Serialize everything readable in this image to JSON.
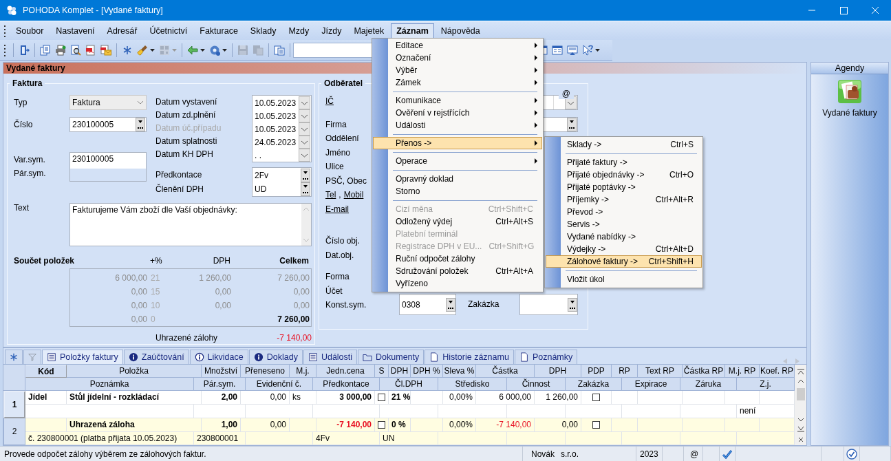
{
  "window": {
    "title": "POHODA Komplet - [Vydané faktury]"
  },
  "menubar": [
    {
      "label": "Soubor",
      "selected": false
    },
    {
      "label": "Nastavení",
      "selected": false
    },
    {
      "label": "Adresář",
      "selected": false
    },
    {
      "label": "Účetnictví",
      "selected": false
    },
    {
      "label": "Fakturace",
      "selected": false
    },
    {
      "label": "Sklady",
      "selected": false
    },
    {
      "label": "Mzdy",
      "selected": false
    },
    {
      "label": "Jízdy",
      "selected": false
    },
    {
      "label": "Majetek",
      "selected": false
    },
    {
      "label": "Záznam",
      "selected": true
    },
    {
      "label": "Nápověda",
      "selected": false
    }
  ],
  "toolbar": {
    "groups": [
      [
        {
          "kind": "door",
          "dropdown": false,
          "disabled": false
        }
      ],
      [
        {
          "kind": "copy",
          "dropdown": false,
          "disabled": false
        },
        {
          "kind": "print",
          "dropdown": false,
          "disabled": false
        },
        {
          "kind": "preview",
          "dropdown": false,
          "disabled": false
        },
        {
          "kind": "pdf",
          "dropdown": false,
          "disabled": false
        },
        {
          "kind": "pdf-mail",
          "dropdown": false,
          "disabled": false
        }
      ],
      [
        {
          "kind": "new",
          "dropdown": false,
          "disabled": false
        },
        {
          "kind": "brush",
          "dropdown": true,
          "disabled": false
        },
        {
          "kind": "qr",
          "dropdown": true,
          "disabled": true
        }
      ],
      [
        {
          "kind": "back",
          "dropdown": true,
          "disabled": false
        },
        {
          "kind": "gear",
          "dropdown": true,
          "disabled": false
        }
      ],
      [
        {
          "kind": "save",
          "dropdown": false,
          "disabled": true
        },
        {
          "kind": "duplicate",
          "dropdown": false,
          "disabled": true
        }
      ],
      [
        {
          "kind": "clipboard",
          "dropdown": false,
          "disabled": false
        }
      ]
    ],
    "right": [
      {
        "kind": "window",
        "dropdown": false,
        "disabled": false
      },
      {
        "kind": "table",
        "dropdown": false,
        "disabled": false
      },
      {
        "kind": "screen",
        "dropdown": false,
        "disabled": false
      },
      {
        "kind": "help",
        "dropdown": true,
        "disabled": false
      }
    ]
  },
  "section_title": "Vydané faktury",
  "faktura": {
    "title": "Faktura",
    "typ": {
      "label": "Typ",
      "value": "Faktura"
    },
    "cislo": {
      "label": "Číslo",
      "value": "230100005"
    },
    "sym": {
      "labels": [
        "Var.sym.",
        "Pár.sym."
      ],
      "value": "230100005"
    },
    "dates": [
      {
        "label": "Datum vystavení",
        "value": "10.05.2023",
        "disabled": false
      },
      {
        "label": "Datum zd.plnění",
        "value": "10.05.2023",
        "disabled": false
      },
      {
        "label": "Datum úč.případu",
        "value": "10.05.2023",
        "disabled": true
      },
      {
        "label": "Datum splatnosti",
        "value": "24.05.2023",
        "disabled": false
      },
      {
        "label": "Datum KH DPH",
        "value": ". .",
        "disabled": false
      }
    ],
    "predkontace": [
      {
        "label": "Předkontace",
        "value": "2Fv"
      },
      {
        "label": "Členění DPH",
        "value": "UD"
      }
    ],
    "text": {
      "label": "Text",
      "value": "Fakturujeme Vám zboží dle Vaší objednávky:"
    },
    "summary": {
      "title": "Součet položek",
      "columns": [
        "+%",
        "DPH",
        "Celkem"
      ],
      "rows": [
        {
          "kind": "rate",
          "base": "6 000,00",
          "rate": "21",
          "vat": "1 260,00",
          "total": "7 260,00"
        },
        {
          "kind": "rate",
          "base": "0,00",
          "rate": "15",
          "vat": "0,00",
          "total": "0,00"
        },
        {
          "kind": "rate",
          "base": "0,00",
          "rate": "10",
          "vat": "0,00",
          "total": "0,00"
        },
        {
          "kind": "total",
          "base": "0,00",
          "rate": "0",
          "total": "7 260,00"
        }
      ]
    },
    "advances": {
      "label": "Uhrazené zálohy",
      "value": "-7 140,00"
    }
  },
  "odberatel": {
    "title": "Odběratel",
    "at": "@",
    "groups": [
      [
        {
          "parts": [
            {
              "text": "IČ",
              "link": true
            }
          ]
        }
      ],
      [
        {
          "parts": [
            {
              "text": "Firma",
              "link": false
            }
          ]
        },
        {
          "parts": [
            {
              "text": "Oddělení",
              "link": false
            }
          ]
        },
        {
          "parts": [
            {
              "text": "Jméno",
              "link": false
            }
          ]
        },
        {
          "parts": [
            {
              "text": "Ulice",
              "link": false
            }
          ]
        },
        {
          "parts": [
            {
              "text": "PSČ, Obec",
              "link": false
            }
          ]
        },
        {
          "parts": [
            {
              "text": "Tel",
              "link": true
            },
            {
              "text": "Mobil",
              "link": true
            }
          ],
          "separator": ","
        },
        {
          "parts": [
            {
              "text": "E-mail",
              "link": true
            }
          ]
        }
      ],
      [
        {
          "parts": [
            {
              "text": "Číslo obj.",
              "link": false
            }
          ]
        },
        {
          "parts": [
            {
              "text": "Dat.obj.",
              "link": false
            }
          ]
        }
      ],
      [
        {
          "parts": [
            {
              "text": "Forma",
              "link": false
            }
          ]
        },
        {
          "parts": [
            {
              "text": "Účet",
              "link": false
            }
          ]
        },
        {
          "parts": [
            {
              "text": "Konst.sym.",
              "link": false
            }
          ]
        }
      ]
    ],
    "konst_sym": "0308",
    "zakazka_label": "Zakázka"
  },
  "menu": {
    "items": [
      {
        "kind": "item",
        "label": "Editace",
        "submenu": true,
        "disabled": false,
        "selected": false
      },
      {
        "kind": "item",
        "label": "Označení",
        "submenu": true,
        "disabled": false,
        "selected": false
      },
      {
        "kind": "item",
        "label": "Výběr",
        "submenu": true,
        "disabled": false,
        "selected": false
      },
      {
        "kind": "item",
        "label": "Zámek",
        "submenu": true,
        "disabled": false,
        "selected": false
      },
      {
        "kind": "separator"
      },
      {
        "kind": "item",
        "label": "Komunikace",
        "submenu": true,
        "disabled": false,
        "selected": false
      },
      {
        "kind": "item",
        "label": "Ověření v rejstřících",
        "submenu": true,
        "disabled": false,
        "selected": false
      },
      {
        "kind": "item",
        "label": "Události",
        "submenu": true,
        "disabled": false,
        "selected": false
      },
      {
        "kind": "separator"
      },
      {
        "kind": "item",
        "label": "Přenos ->",
        "submenu": true,
        "disabled": false,
        "selected": true
      },
      {
        "kind": "separator"
      },
      {
        "kind": "item",
        "label": "Operace",
        "submenu": true,
        "disabled": false,
        "selected": false
      },
      {
        "kind": "separator"
      },
      {
        "kind": "item",
        "label": "Opravný doklad",
        "submenu": false,
        "disabled": false,
        "selected": false
      },
      {
        "kind": "item",
        "label": "Storno",
        "submenu": false,
        "disabled": false,
        "selected": false
      },
      {
        "kind": "separator"
      },
      {
        "kind": "item",
        "label": "Cizí měna",
        "shortcut": "Ctrl+Shift+C",
        "submenu": false,
        "disabled": true,
        "selected": false
      },
      {
        "kind": "item",
        "label": "Odložený výdej",
        "shortcut": "Ctrl+Alt+S",
        "submenu": false,
        "disabled": false,
        "selected": false
      },
      {
        "kind": "item",
        "label": "Platební terminál",
        "submenu": false,
        "disabled": true,
        "selected": false
      },
      {
        "kind": "item",
        "label": "Registrace DPH v EU...",
        "shortcut": "Ctrl+Shift+G",
        "submenu": false,
        "disabled": true,
        "selected": false
      },
      {
        "kind": "item",
        "label": "Ruční odpočet zálohy",
        "submenu": false,
        "disabled": false,
        "selected": false
      },
      {
        "kind": "item",
        "label": "Sdružování položek",
        "shortcut": "Ctrl+Alt+A",
        "submenu": false,
        "disabled": false,
        "selected": false
      },
      {
        "kind": "item",
        "label": "Vyřízeno",
        "submenu": false,
        "disabled": false,
        "selected": false
      }
    ]
  },
  "submenu": {
    "items": [
      {
        "kind": "item",
        "label": "Sklady ->",
        "shortcut": "Ctrl+S",
        "selected": false
      },
      {
        "kind": "separator"
      },
      {
        "kind": "item",
        "label": "Přijaté faktury ->",
        "selected": false
      },
      {
        "kind": "item",
        "label": "Přijaté objednávky ->",
        "shortcut": "Ctrl+O",
        "selected": false
      },
      {
        "kind": "item",
        "label": "Přijaté poptávky ->",
        "selected": false
      },
      {
        "kind": "item",
        "label": "Příjemky ->",
        "shortcut": "Ctrl+Alt+R",
        "selected": false
      },
      {
        "kind": "item",
        "label": "Převod ->",
        "selected": false
      },
      {
        "kind": "item",
        "label": "Servis ->",
        "selected": false
      },
      {
        "kind": "item",
        "label": "Vydané nabídky ->",
        "selected": false
      },
      {
        "kind": "item",
        "label": "Výdejky ->",
        "shortcut": "Ctrl+Alt+D",
        "selected": false
      },
      {
        "kind": "item",
        "label": "Zálohové faktury ->",
        "shortcut": "Ctrl+Shift+H",
        "selected": true
      },
      {
        "kind": "separator"
      },
      {
        "kind": "item",
        "label": "Vložit úkol",
        "selected": false
      }
    ]
  },
  "agenda": {
    "title": "Agendy",
    "items": [
      {
        "label": "Vydané faktury"
      }
    ]
  },
  "tabs": [
    {
      "kind": "new",
      "selected": false
    },
    {
      "kind": "filter",
      "selected": false
    },
    {
      "kind": "list",
      "label": "Položky faktury",
      "selected": true
    },
    {
      "kind": "info",
      "label": "Zaúčtování",
      "selected": false
    },
    {
      "kind": "info-outline",
      "label": "Likvidace",
      "selected": false
    },
    {
      "kind": "info",
      "label": "Doklady",
      "selected": false
    },
    {
      "kind": "list",
      "label": "Události",
      "selected": false
    },
    {
      "kind": "folder",
      "label": "Dokumenty",
      "selected": false
    },
    {
      "kind": "page",
      "label": "Historie záznamu",
      "selected": false
    },
    {
      "kind": "page",
      "label": "Poznámky",
      "selected": false
    }
  ],
  "grid": {
    "header1": [
      "Kód",
      "Položka",
      "Množství",
      "Přeneseno",
      "M.j.",
      "Jedn.cena",
      "S",
      "DPH",
      "DPH %",
      "Sleva %",
      "Částka",
      "DPH",
      "PDP",
      "RP",
      "Text RP",
      "Částka RP",
      "M.j. RP",
      "Koef. RP"
    ],
    "header2": [
      "Poznámka",
      "Pár.sym.",
      "Evidenční č.",
      "Předkontace",
      "Čl.DPH",
      "Středisko",
      "Činnost",
      "Zakázka",
      "Expirace",
      "Záruka",
      "Z.j."
    ],
    "rows": [
      {
        "number": "1",
        "selected": true,
        "kind": "item",
        "line1": {
          "kod": "Jídel",
          "polozka": "Stůl jídelní - rozkládací",
          "mnozstvi": "2,00",
          "preneseno": "0,00",
          "mj": "ks",
          "jedn_cena": "3 000,00",
          "s": false,
          "dph": "21 %",
          "sleva": "0,00%",
          "castka": "6 000,00",
          "dph_castka": "1 260,00",
          "pdp": false
        },
        "line2": {
          "zj": "není"
        }
      },
      {
        "number": "2",
        "selected": false,
        "kind": "advance",
        "line1": {
          "polozka": "Uhrazená záloha",
          "mnozstvi": "1,00",
          "preneseno": "0,00",
          "jedn_cena": "-7 140,00",
          "s": false,
          "dph": "0 %",
          "sleva": "0,00%",
          "castka": "-7 140,00",
          "dph_castka": "0,00",
          "pdp": false
        },
        "line2": {
          "poznamka": "č. 230800001 (platba přijata 10.05.2023)",
          "par_sym": "230800001",
          "predkontace": "4Fv",
          "cl_dph": "UN"
        }
      }
    ]
  },
  "status_bar": {
    "message": "Provede odpočet zálohy výběrem ze zálohových faktur.",
    "user": "Novák",
    "company": "s.r.o.",
    "year": "2023",
    "at": "@"
  }
}
